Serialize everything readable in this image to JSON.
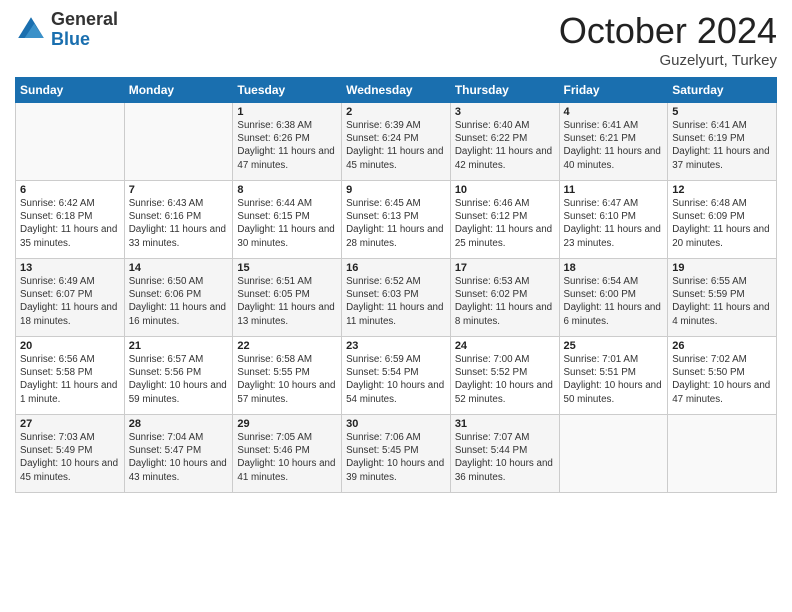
{
  "logo": {
    "general": "General",
    "blue": "Blue"
  },
  "header": {
    "title": "October 2024",
    "subtitle": "Guzelyurt, Turkey"
  },
  "calendar": {
    "headers": [
      "Sunday",
      "Monday",
      "Tuesday",
      "Wednesday",
      "Thursday",
      "Friday",
      "Saturday"
    ],
    "rows": [
      [
        {
          "day": "",
          "sunrise": "",
          "sunset": "",
          "daylight": ""
        },
        {
          "day": "",
          "sunrise": "",
          "sunset": "",
          "daylight": ""
        },
        {
          "day": "1",
          "sunrise": "Sunrise: 6:38 AM",
          "sunset": "Sunset: 6:26 PM",
          "daylight": "Daylight: 11 hours and 47 minutes."
        },
        {
          "day": "2",
          "sunrise": "Sunrise: 6:39 AM",
          "sunset": "Sunset: 6:24 PM",
          "daylight": "Daylight: 11 hours and 45 minutes."
        },
        {
          "day": "3",
          "sunrise": "Sunrise: 6:40 AM",
          "sunset": "Sunset: 6:22 PM",
          "daylight": "Daylight: 11 hours and 42 minutes."
        },
        {
          "day": "4",
          "sunrise": "Sunrise: 6:41 AM",
          "sunset": "Sunset: 6:21 PM",
          "daylight": "Daylight: 11 hours and 40 minutes."
        },
        {
          "day": "5",
          "sunrise": "Sunrise: 6:41 AM",
          "sunset": "Sunset: 6:19 PM",
          "daylight": "Daylight: 11 hours and 37 minutes."
        }
      ],
      [
        {
          "day": "6",
          "sunrise": "Sunrise: 6:42 AM",
          "sunset": "Sunset: 6:18 PM",
          "daylight": "Daylight: 11 hours and 35 minutes."
        },
        {
          "day": "7",
          "sunrise": "Sunrise: 6:43 AM",
          "sunset": "Sunset: 6:16 PM",
          "daylight": "Daylight: 11 hours and 33 minutes."
        },
        {
          "day": "8",
          "sunrise": "Sunrise: 6:44 AM",
          "sunset": "Sunset: 6:15 PM",
          "daylight": "Daylight: 11 hours and 30 minutes."
        },
        {
          "day": "9",
          "sunrise": "Sunrise: 6:45 AM",
          "sunset": "Sunset: 6:13 PM",
          "daylight": "Daylight: 11 hours and 28 minutes."
        },
        {
          "day": "10",
          "sunrise": "Sunrise: 6:46 AM",
          "sunset": "Sunset: 6:12 PM",
          "daylight": "Daylight: 11 hours and 25 minutes."
        },
        {
          "day": "11",
          "sunrise": "Sunrise: 6:47 AM",
          "sunset": "Sunset: 6:10 PM",
          "daylight": "Daylight: 11 hours and 23 minutes."
        },
        {
          "day": "12",
          "sunrise": "Sunrise: 6:48 AM",
          "sunset": "Sunset: 6:09 PM",
          "daylight": "Daylight: 11 hours and 20 minutes."
        }
      ],
      [
        {
          "day": "13",
          "sunrise": "Sunrise: 6:49 AM",
          "sunset": "Sunset: 6:07 PM",
          "daylight": "Daylight: 11 hours and 18 minutes."
        },
        {
          "day": "14",
          "sunrise": "Sunrise: 6:50 AM",
          "sunset": "Sunset: 6:06 PM",
          "daylight": "Daylight: 11 hours and 16 minutes."
        },
        {
          "day": "15",
          "sunrise": "Sunrise: 6:51 AM",
          "sunset": "Sunset: 6:05 PM",
          "daylight": "Daylight: 11 hours and 13 minutes."
        },
        {
          "day": "16",
          "sunrise": "Sunrise: 6:52 AM",
          "sunset": "Sunset: 6:03 PM",
          "daylight": "Daylight: 11 hours and 11 minutes."
        },
        {
          "day": "17",
          "sunrise": "Sunrise: 6:53 AM",
          "sunset": "Sunset: 6:02 PM",
          "daylight": "Daylight: 11 hours and 8 minutes."
        },
        {
          "day": "18",
          "sunrise": "Sunrise: 6:54 AM",
          "sunset": "Sunset: 6:00 PM",
          "daylight": "Daylight: 11 hours and 6 minutes."
        },
        {
          "day": "19",
          "sunrise": "Sunrise: 6:55 AM",
          "sunset": "Sunset: 5:59 PM",
          "daylight": "Daylight: 11 hours and 4 minutes."
        }
      ],
      [
        {
          "day": "20",
          "sunrise": "Sunrise: 6:56 AM",
          "sunset": "Sunset: 5:58 PM",
          "daylight": "Daylight: 11 hours and 1 minute."
        },
        {
          "day": "21",
          "sunrise": "Sunrise: 6:57 AM",
          "sunset": "Sunset: 5:56 PM",
          "daylight": "Daylight: 10 hours and 59 minutes."
        },
        {
          "day": "22",
          "sunrise": "Sunrise: 6:58 AM",
          "sunset": "Sunset: 5:55 PM",
          "daylight": "Daylight: 10 hours and 57 minutes."
        },
        {
          "day": "23",
          "sunrise": "Sunrise: 6:59 AM",
          "sunset": "Sunset: 5:54 PM",
          "daylight": "Daylight: 10 hours and 54 minutes."
        },
        {
          "day": "24",
          "sunrise": "Sunrise: 7:00 AM",
          "sunset": "Sunset: 5:52 PM",
          "daylight": "Daylight: 10 hours and 52 minutes."
        },
        {
          "day": "25",
          "sunrise": "Sunrise: 7:01 AM",
          "sunset": "Sunset: 5:51 PM",
          "daylight": "Daylight: 10 hours and 50 minutes."
        },
        {
          "day": "26",
          "sunrise": "Sunrise: 7:02 AM",
          "sunset": "Sunset: 5:50 PM",
          "daylight": "Daylight: 10 hours and 47 minutes."
        }
      ],
      [
        {
          "day": "27",
          "sunrise": "Sunrise: 7:03 AM",
          "sunset": "Sunset: 5:49 PM",
          "daylight": "Daylight: 10 hours and 45 minutes."
        },
        {
          "day": "28",
          "sunrise": "Sunrise: 7:04 AM",
          "sunset": "Sunset: 5:47 PM",
          "daylight": "Daylight: 10 hours and 43 minutes."
        },
        {
          "day": "29",
          "sunrise": "Sunrise: 7:05 AM",
          "sunset": "Sunset: 5:46 PM",
          "daylight": "Daylight: 10 hours and 41 minutes."
        },
        {
          "day": "30",
          "sunrise": "Sunrise: 7:06 AM",
          "sunset": "Sunset: 5:45 PM",
          "daylight": "Daylight: 10 hours and 39 minutes."
        },
        {
          "day": "31",
          "sunrise": "Sunrise: 7:07 AM",
          "sunset": "Sunset: 5:44 PM",
          "daylight": "Daylight: 10 hours and 36 minutes."
        },
        {
          "day": "",
          "sunrise": "",
          "sunset": "",
          "daylight": ""
        },
        {
          "day": "",
          "sunrise": "",
          "sunset": "",
          "daylight": ""
        }
      ]
    ]
  }
}
